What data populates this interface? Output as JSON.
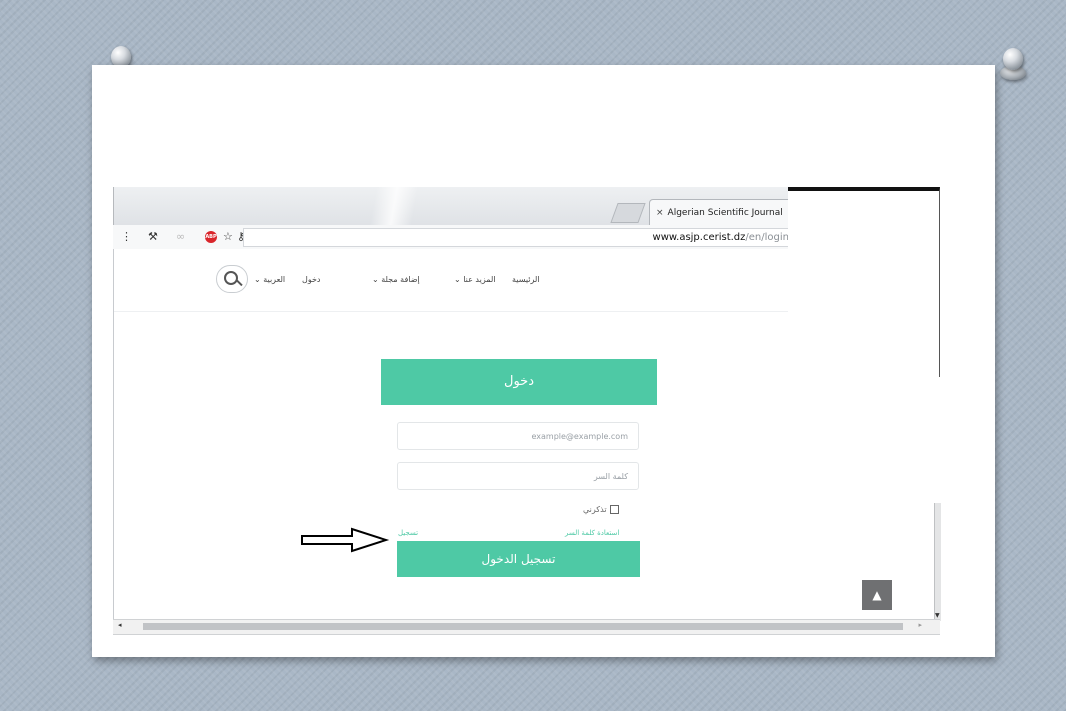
{
  "browser": {
    "tab_title": "Algerian Scientific Journal",
    "tab_close": "×",
    "url_domain": "www.asjp.cerist.dz",
    "url_path": "/en/login",
    "toolbar_icons": [
      "menu-dots-icon",
      "tools-icon",
      "abp-adblock-icon",
      "star-icon",
      "extension-icon"
    ],
    "abp_label": "ABP"
  },
  "nav": {
    "items": [
      {
        "label": "الرئيسية",
        "name": "nav-home"
      },
      {
        "label": "المزيد عنا ⌄",
        "name": "nav-about"
      },
      {
        "label": "إضافة مجلة ⌄",
        "name": "nav-add-journal"
      },
      {
        "label": "دخول",
        "name": "nav-login"
      },
      {
        "label": "العربية ⌄",
        "name": "nav-language"
      }
    ]
  },
  "login": {
    "title": "دخول",
    "email_placeholder": "example@example.com",
    "password_placeholder": "كلمة السر",
    "remember_label": "تذكرني",
    "forgot_link": "استعادة كلمة السر",
    "register_link": "تسجيل",
    "submit_label": "تسجيل الدخول"
  },
  "misc": {
    "scroll_top_icon": "▲",
    "accent_color": "#4ec9a5"
  }
}
